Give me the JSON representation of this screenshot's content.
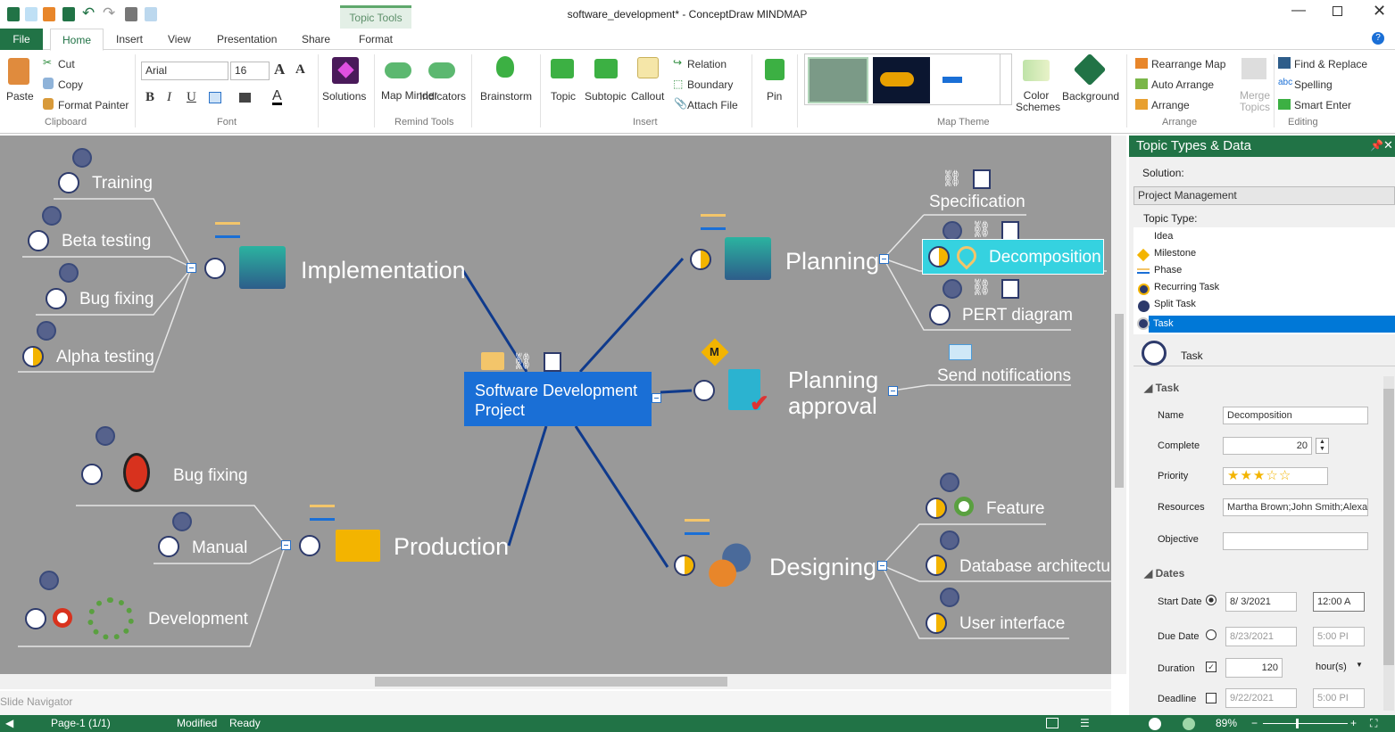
{
  "window": {
    "title": "software_development* - ConceptDraw MINDMAP",
    "contextual_tab": "Topic Tools"
  },
  "tabs": [
    "File",
    "Home",
    "Insert",
    "View",
    "Presentation",
    "Share",
    "Format"
  ],
  "ribbon": {
    "clipboard": {
      "paste": "Paste",
      "cut": "Cut",
      "copy": "Copy",
      "format_painter": "Format Painter",
      "group": "Clipboard"
    },
    "font": {
      "family": "Arial",
      "size": "16",
      "group": "Font"
    },
    "solutions": "Solutions",
    "remind": {
      "map_minder": "Map Minder",
      "indicators": "Indicators",
      "group": "Remind Tools"
    },
    "brainstorm": "Brainstorm",
    "insert": {
      "topic": "Topic",
      "subtopic": "Subtopic",
      "callout": "Callout",
      "relation": "Relation",
      "boundary": "Boundary",
      "attach_file": "Attach File",
      "group": "Insert"
    },
    "pin": "Pin",
    "theme": {
      "color_schemes": "Color Schemes",
      "background": "Background",
      "group": "Map Theme"
    },
    "arrange": {
      "rearrange": "Rearrange Map",
      "auto": "Auto Arrange",
      "arrange": "Arrange",
      "merge": "Merge Topics",
      "group": "Arrange"
    },
    "editing": {
      "find": "Find & Replace",
      "spelling": "Spelling",
      "smart_enter": "Smart Enter",
      "group": "Editing"
    }
  },
  "map": {
    "central": "Software Development Project",
    "implementation": {
      "label": "Implementation",
      "children": [
        "Training",
        "Beta testing",
        "Bug fixing",
        "Alpha testing"
      ]
    },
    "planning": {
      "label": "Planning",
      "children": [
        "Specification",
        "Decomposition",
        "PERT diagram"
      ]
    },
    "planning_approval": {
      "label": "Planning approval",
      "children": [
        "Send notifications"
      ],
      "milestone": "M"
    },
    "production": {
      "label": "Production",
      "children": [
        "Bug fixing",
        "Manual",
        "Development"
      ]
    },
    "designing": {
      "label": "Designing",
      "children": [
        "Feature",
        "Database architecture",
        "User interface"
      ]
    }
  },
  "slide_navigator": "Slide Navigator",
  "panel": {
    "title": "Topic Types & Data",
    "solution_label": "Solution:",
    "solution": "Project Management",
    "topic_type_label": "Topic Type:",
    "types": [
      "Idea",
      "Milestone",
      "Phase",
      "Recurring Task",
      "Split Task",
      "Task"
    ],
    "selected_type": "Task",
    "task_section": "Task",
    "name_label": "Name",
    "name": "Decomposition",
    "complete_label": "Complete",
    "complete": "20",
    "priority_label": "Priority",
    "priority": 3,
    "priority_max": 5,
    "resources_label": "Resources",
    "resources": "Martha Brown;John Smith;Alexa",
    "objective_label": "Objective",
    "objective": "",
    "dates_section": "Dates",
    "start_label": "Start Date",
    "start_date": "8/ 3/2021",
    "start_time": "12:00 A",
    "due_label": "Due Date",
    "due_date": "8/23/2021",
    "due_time": "5:00 PI",
    "duration_label": "Duration",
    "duration": "120",
    "duration_unit": "hour(s)",
    "deadline_label": "Deadline",
    "deadline_date": "9/22/2021",
    "deadline_time": "5:00 PI"
  },
  "status": {
    "page": "Page-1 (1/1)",
    "modified": "Modified",
    "ready": "Ready",
    "zoom": "89%"
  },
  "colors": {
    "accent": "#217346",
    "selection": "#0078d7",
    "central": "#1a6fd6",
    "canvas": "#999999"
  }
}
